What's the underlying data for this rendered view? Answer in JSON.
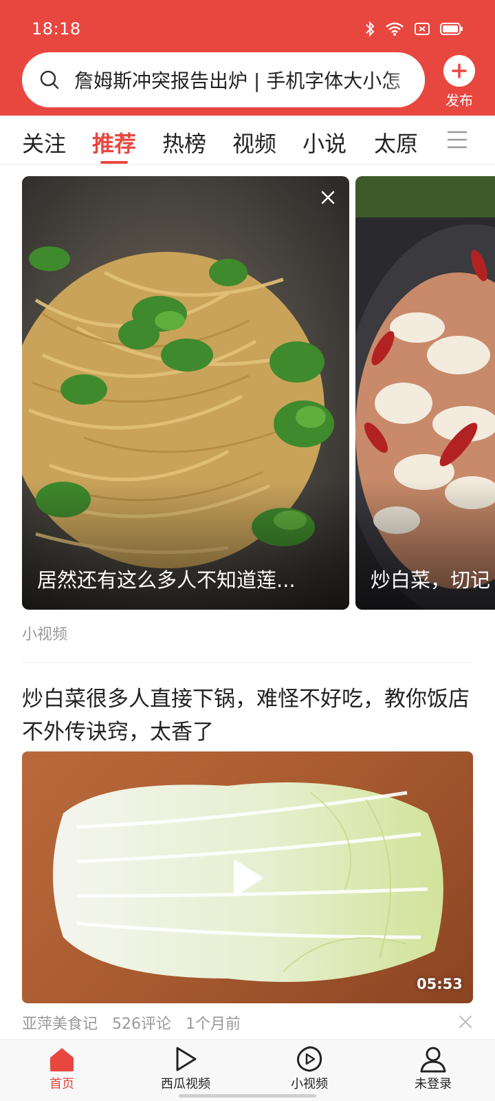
{
  "status_bar": {
    "time": "18:18"
  },
  "search": {
    "text": "詹姆斯冲突报告出炉 | 手机字体大小怎"
  },
  "publish": {
    "label": "发布"
  },
  "tabs": [
    {
      "label": "关注"
    },
    {
      "label": "推荐"
    },
    {
      "label": "热榜"
    },
    {
      "label": "视频"
    },
    {
      "label": "小说"
    },
    {
      "label": "太原"
    }
  ],
  "carousel": {
    "cards": [
      {
        "caption": "居然还有这么多人不知道莲..."
      },
      {
        "caption": "炒白菜，切记"
      }
    ],
    "section_label": "小视频"
  },
  "article": {
    "title": "炒白菜很多人直接下锅，难怪不好吃，教你饭店不外传诀窍，太香了",
    "duration": "05:53",
    "author": "亚萍美食记",
    "comments": "526评论",
    "time": "1个月前"
  },
  "bottom_nav": [
    {
      "label": "首页"
    },
    {
      "label": "西瓜视频"
    },
    {
      "label": "小视频"
    },
    {
      "label": "未登录"
    }
  ],
  "colors": {
    "brand": "#e8473f"
  }
}
